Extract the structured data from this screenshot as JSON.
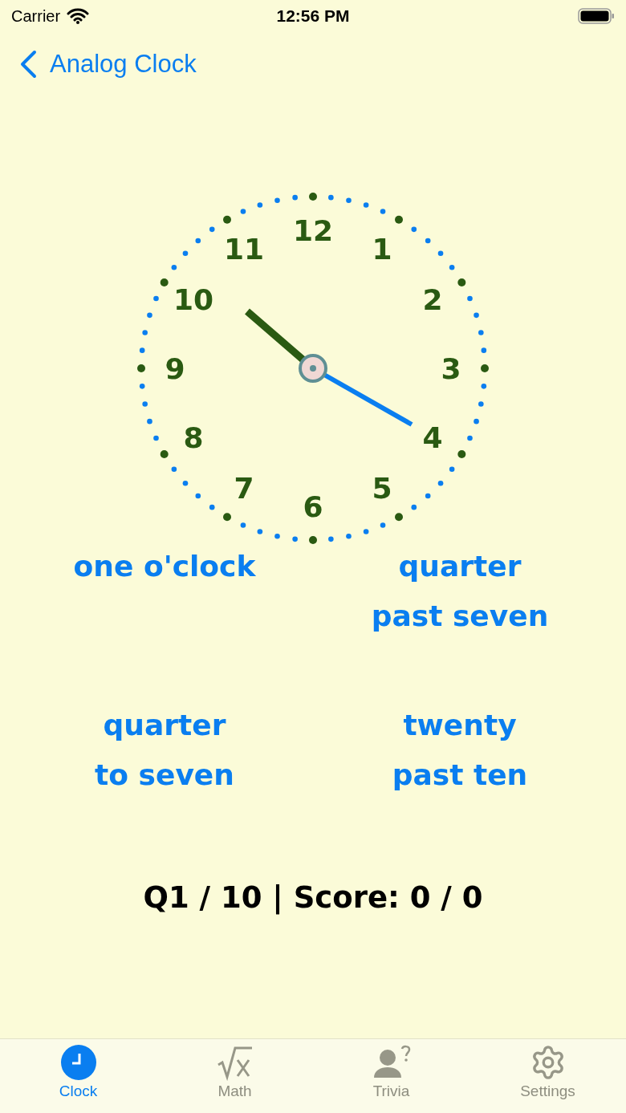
{
  "status_bar": {
    "carrier": "Carrier",
    "time": "12:56 PM"
  },
  "nav": {
    "back_label": "Analog Clock"
  },
  "clock": {
    "numbers": [
      "12",
      "1",
      "2",
      "3",
      "4",
      "5",
      "6",
      "7",
      "8",
      "9",
      "10",
      "11"
    ]
  },
  "answers": [
    {
      "lines": [
        "one o'clock"
      ]
    },
    {
      "lines": [
        "quarter",
        "past seven"
      ]
    },
    {
      "lines": [
        "quarter",
        "to seven"
      ]
    },
    {
      "lines": [
        "twenty",
        "past ten"
      ]
    }
  ],
  "score": "Q1 / 10 | Score: 0 / 0",
  "tabs": [
    {
      "kind": "clock",
      "label": "Clock",
      "selected": true
    },
    {
      "kind": "math",
      "label": "Math",
      "selected": false
    },
    {
      "kind": "trivia",
      "label": "Trivia",
      "selected": false
    },
    {
      "kind": "settings",
      "label": "Settings",
      "selected": false
    }
  ]
}
